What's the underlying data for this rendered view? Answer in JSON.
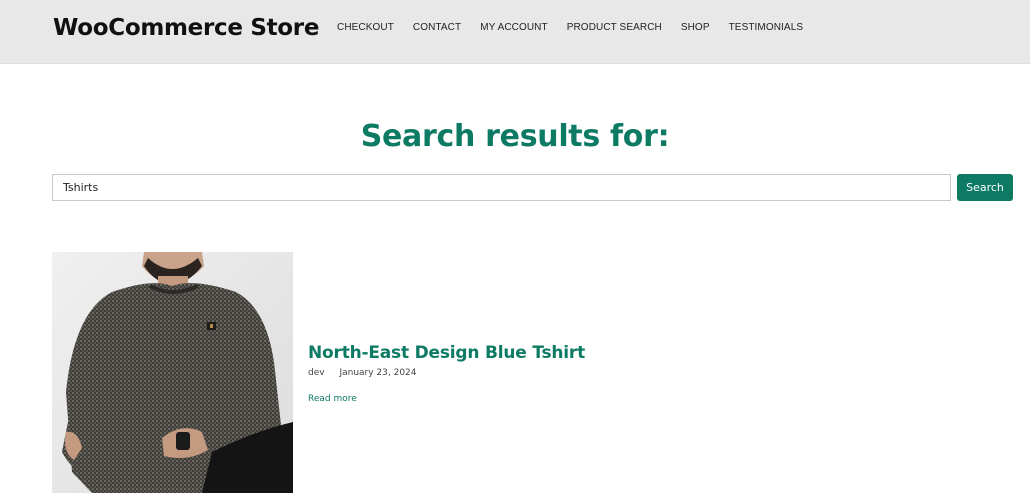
{
  "header": {
    "site_title": "WooCommerce Store",
    "nav": [
      {
        "label": "CHECKOUT"
      },
      {
        "label": "CONTACT"
      },
      {
        "label": "MY ACCOUNT"
      },
      {
        "label": "PRODUCT SEARCH"
      },
      {
        "label": "SHOP"
      },
      {
        "label": "TESTIMONIALS"
      }
    ]
  },
  "main": {
    "heading": "Search results for:",
    "search": {
      "value": "Tshirts",
      "button_label": "Search"
    },
    "results": [
      {
        "title": "North-East Design Blue Tshirt",
        "author": "dev",
        "date": "January 23, 2024",
        "read_more": "Read more"
      }
    ]
  },
  "colors": {
    "accent": "#0d7a63",
    "header_bg": "#e8e8e8"
  }
}
